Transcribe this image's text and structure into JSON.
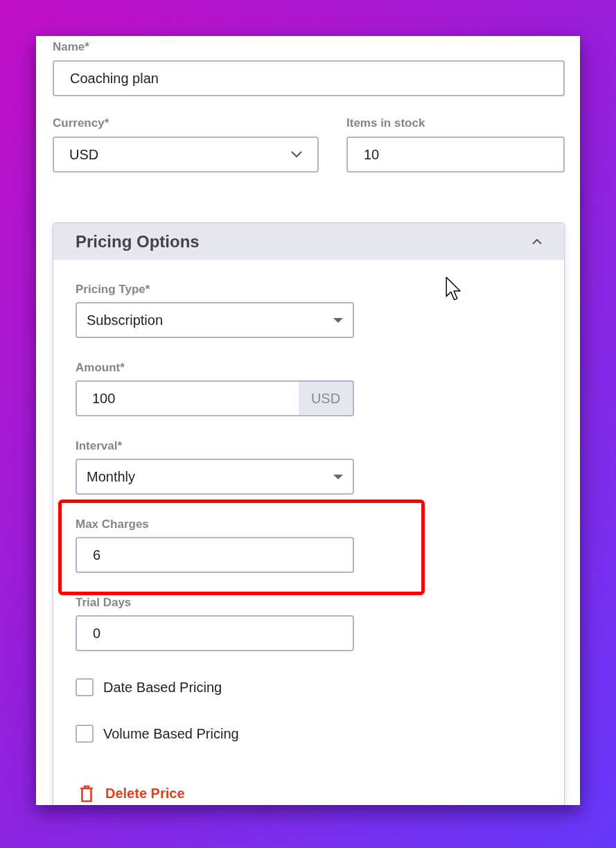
{
  "rows": [
    [
      {
        "kind": "text",
        "label": "Name*",
        "value": "Coaching plan"
      }
    ],
    [
      {
        "kind": "dropdown",
        "label": "Currency*",
        "value": "USD"
      },
      {
        "kind": "text",
        "label": "Items in stock",
        "value": "10"
      }
    ]
  ],
  "pricing_options": {
    "title": "Pricing Options",
    "expanded": true,
    "fields": [
      {
        "kind": "select",
        "label": "Pricing Type*",
        "value": "Subscription",
        "highlighted": false
      },
      {
        "kind": "addon",
        "label": "Amount*",
        "value": "100",
        "addon": "USD",
        "highlighted": false
      },
      {
        "kind": "select",
        "label": "Interval*",
        "value": "Monthly",
        "highlighted": false
      },
      {
        "kind": "text",
        "label": "Max Charges",
        "value": "6",
        "highlighted": true
      },
      {
        "kind": "text",
        "label": "Trial Days",
        "value": "0",
        "highlighted": false
      }
    ],
    "checkboxes": [
      {
        "label": "Date Based Pricing",
        "checked": false
      },
      {
        "label": "Volume Based Pricing",
        "checked": false
      }
    ],
    "delete_button": "Delete Price"
  }
}
